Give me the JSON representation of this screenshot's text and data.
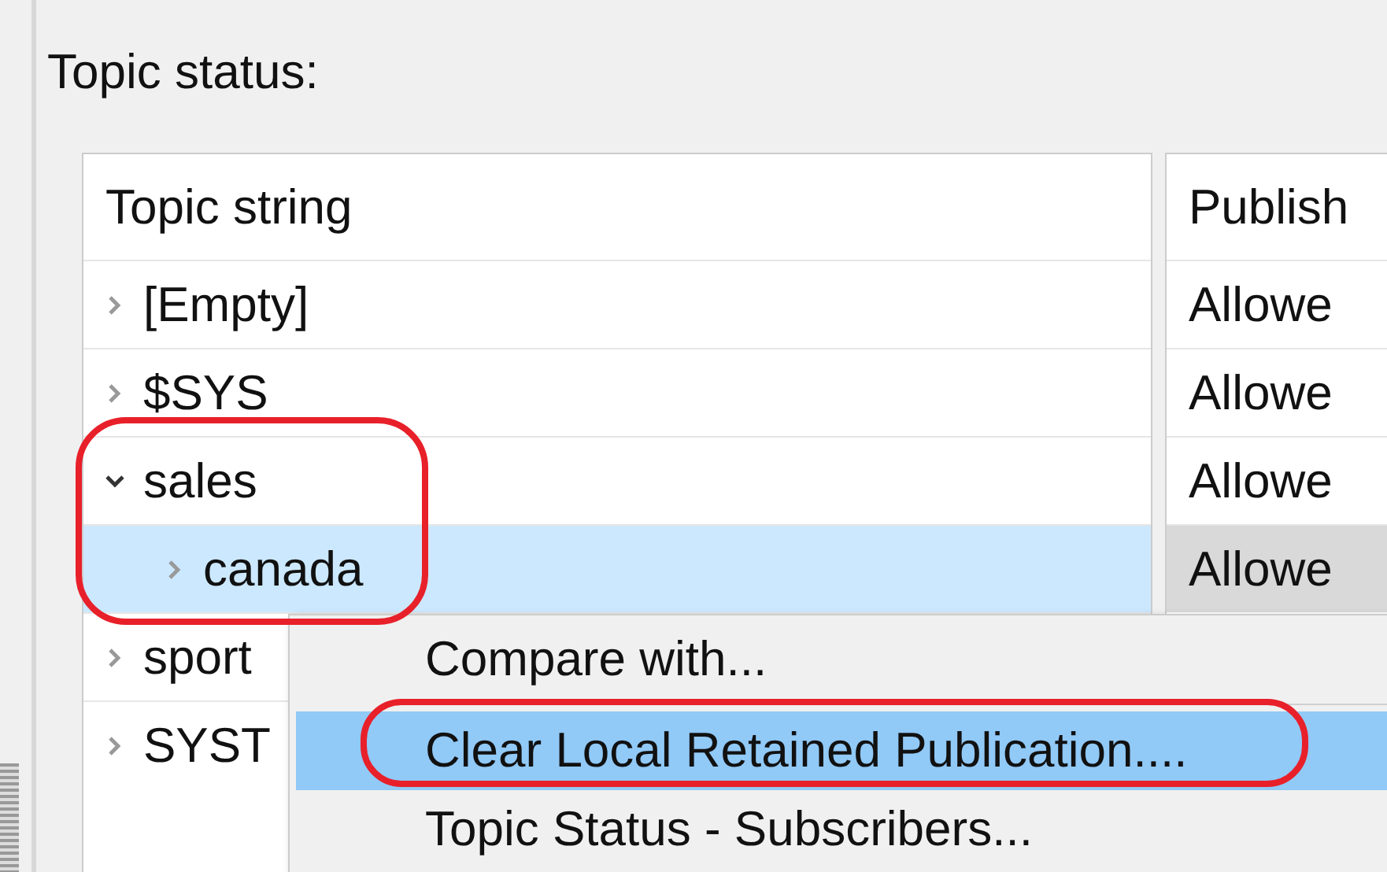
{
  "panel": {
    "label": "Topic status:"
  },
  "tree": {
    "header": "Topic string",
    "rows": [
      {
        "label": "[Empty]",
        "expanded": false,
        "selected": false
      },
      {
        "label": "$SYS",
        "expanded": false,
        "selected": false
      },
      {
        "label": "sales",
        "expanded": true,
        "selected": false,
        "children": [
          {
            "label": "canada",
            "expanded": false,
            "selected": true
          }
        ]
      },
      {
        "label": "sport",
        "expanded": false,
        "selected": false
      },
      {
        "label": "SYST",
        "expanded": false,
        "selected": false
      }
    ]
  },
  "status_column": {
    "header": "Publish",
    "cells": [
      {
        "text": "Allowe",
        "selected": false
      },
      {
        "text": "Allowe",
        "selected": false
      },
      {
        "text": "Allowe",
        "selected": false
      },
      {
        "text": "Allowe",
        "selected": true
      }
    ]
  },
  "context_menu": {
    "items": [
      {
        "kind": "item",
        "label": "Compare with...",
        "selected": false
      },
      {
        "kind": "separator"
      },
      {
        "kind": "item",
        "label": "Clear Local Retained Publication....",
        "selected": true
      },
      {
        "kind": "item",
        "label": "Topic Status - Subscribers...",
        "selected": false
      }
    ]
  }
}
